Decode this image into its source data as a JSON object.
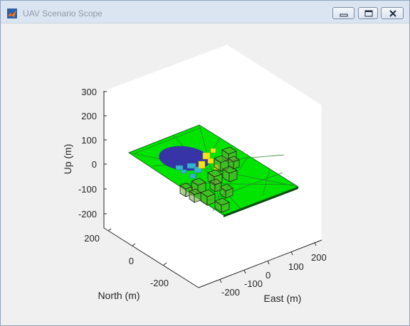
{
  "window": {
    "title": "UAV Scenario Scope",
    "controls": {
      "minimize": "minimize-icon",
      "maximize": "maximize-icon",
      "close": "close-icon"
    }
  },
  "plot": {
    "up_axis_label": "Up (m)",
    "north_axis_label": "North (m)",
    "east_axis_label": "East (m)",
    "up_ticks": [
      "300",
      "200",
      "100",
      "0",
      "-100",
      "-200"
    ],
    "north_ticks": [
      "200",
      "0",
      "-200"
    ],
    "east_ticks": [
      "-200",
      "-100",
      "0",
      "100",
      "200"
    ],
    "colors": {
      "ground_plane": "#00e400",
      "water_region": "#3634a6",
      "yellow_obstacles": "#f5e31a",
      "cyan_obstacles": "#35b3d4",
      "building_boxes": "#4a8e2e"
    }
  }
}
